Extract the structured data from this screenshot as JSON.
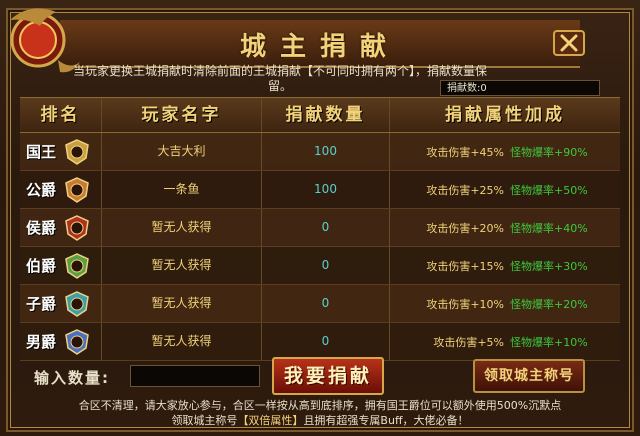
{
  "title": "城主捐献",
  "close_icon": "close-x-icon",
  "notice": "当玩家更换王城捐献时清除前面的王城捐献【不可同时拥有两个】，捐献数量保留。",
  "donated_label": "捐献数:0",
  "table": {
    "headers": [
      "排名",
      "玩家名字",
      "捐献数量",
      "捐献属性加成"
    ],
    "rows": [
      {
        "rank": "国王",
        "badge_color": "#c8a040",
        "name": "大吉大利",
        "amount": "100",
        "atk": "攻击伤害+45%",
        "drop": "怪物爆率+90%"
      },
      {
        "rank": "公爵",
        "badge_color": "#c87a30",
        "name": "一条鱼",
        "amount": "100",
        "atk": "攻击伤害+25%",
        "drop": "怪物爆率+50%"
      },
      {
        "rank": "侯爵",
        "badge_color": "#b03020",
        "name": "暂无人获得",
        "amount": "0",
        "atk": "攻击伤害+20%",
        "drop": "怪物爆率+40%"
      },
      {
        "rank": "伯爵",
        "badge_color": "#5aa040",
        "name": "暂无人获得",
        "amount": "0",
        "atk": "攻击伤害+15%",
        "drop": "怪物爆率+30%"
      },
      {
        "rank": "子爵",
        "badge_color": "#3aa0a8",
        "name": "暂无人获得",
        "amount": "0",
        "atk": "攻击伤害+10%",
        "drop": "怪物爆率+20%"
      },
      {
        "rank": "男爵",
        "badge_color": "#4a70c0",
        "name": "暂无人获得",
        "amount": "0",
        "atk": "攻击伤害+5%",
        "drop": "怪物爆率+10%"
      }
    ]
  },
  "input_label": "输入数量:",
  "quantity_value": "",
  "donate_button": "我要捐献",
  "claim_button": "领取城主称号",
  "footer_line1": "合区不清理，请大家放心参与，合区一样按从高到底排序，拥有国王爵位可以额外使用500%沉默点",
  "footer_line2_pre": "领取城主称号",
  "footer_line2_hl": "【双倍属性】",
  "footer_line2_post": "且拥有超强专属Buff，大佬必备！"
}
